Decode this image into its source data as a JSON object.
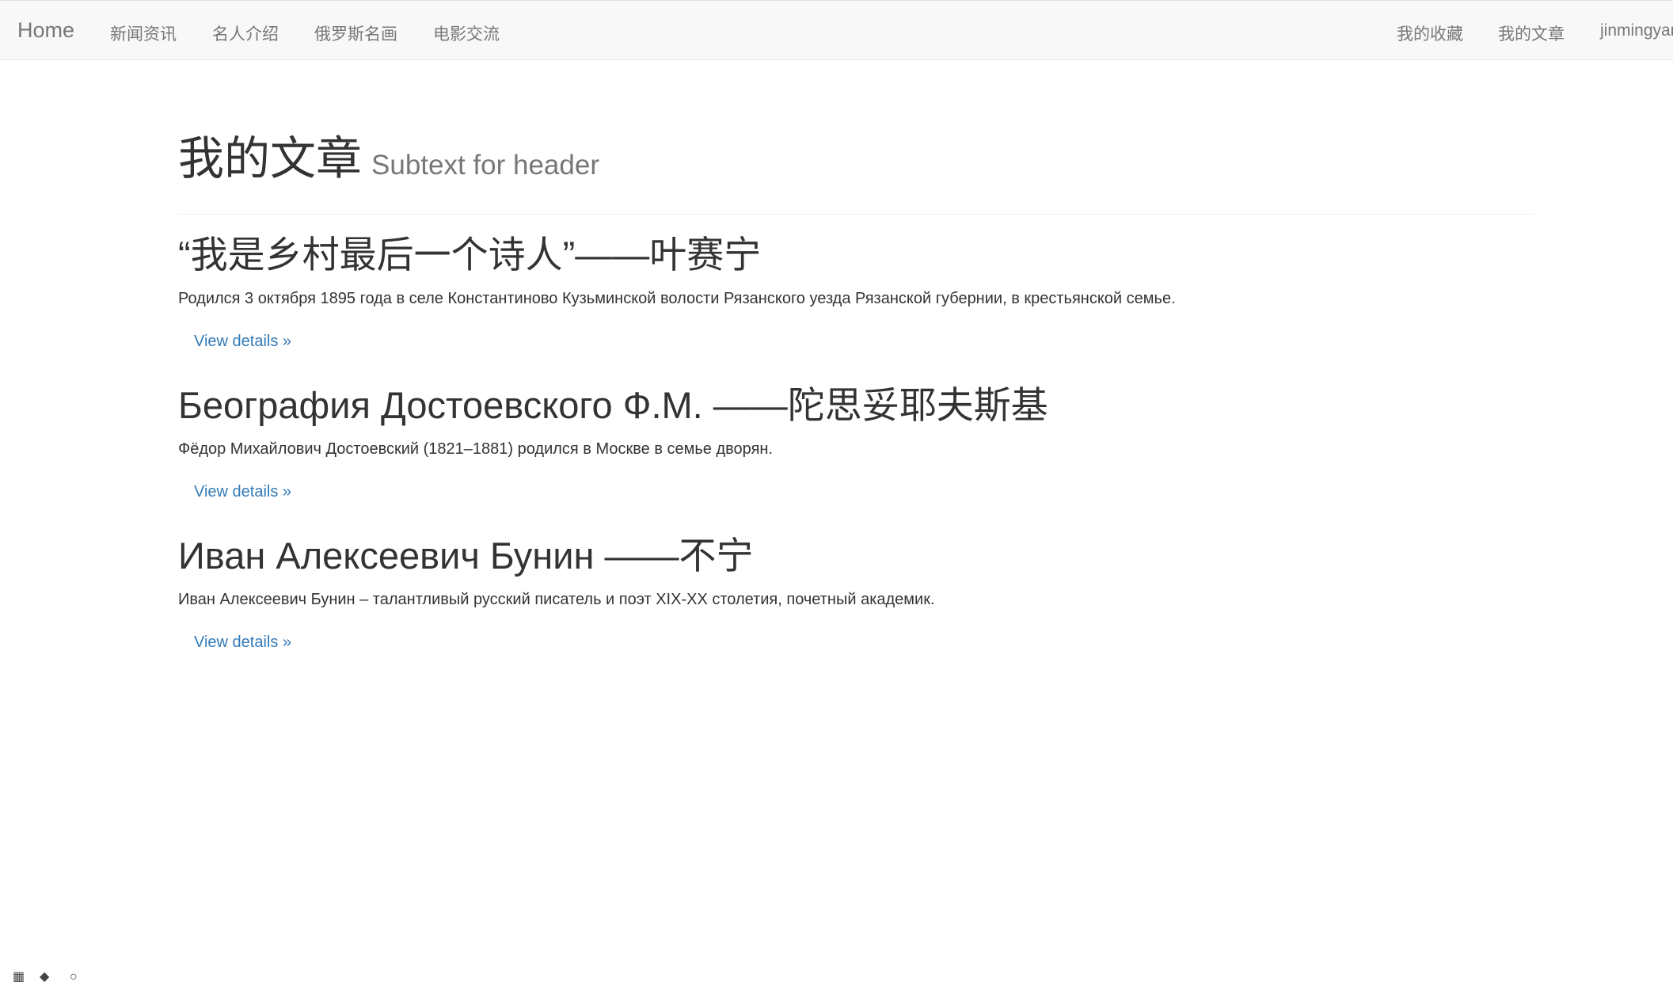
{
  "navbar": {
    "brand": "Home",
    "left_items": [
      "新闻资讯",
      "名人介绍",
      "俄罗斯名画",
      "电影交流"
    ],
    "right_items": [
      "我的收藏",
      "我的文章",
      "jinmingyan"
    ]
  },
  "header": {
    "title": "我的文章",
    "subtitle": "Subtext for header"
  },
  "articles": [
    {
      "title": "“我是乡村最后一个诗人”——叶赛宁",
      "summary": "Родился 3 октября 1895 года в селе Константиново Кузьминской волости Рязанского уезда Рязанской губернии, в крестьянской семье.",
      "link": "View details »"
    },
    {
      "title": "Беография Достоевского Ф.М. ——陀思妥耶夫斯基",
      "summary": "Фёдор Михайлович Достоевский (1821–1881) родился в Москве в семье дворян.",
      "link": "View details »"
    },
    {
      "title": "Иван Алексеевич Бунин ——不宁",
      "summary": "Иван Алексеевич Бунин – талантливый русский писатель и поэт XIX-XX столетия, почетный академик.",
      "link": "View details »"
    }
  ],
  "colors": {
    "navbar_bg": "#f8f8f8",
    "nav_text": "#777777",
    "link": "#337ab7",
    "text": "#333333"
  }
}
